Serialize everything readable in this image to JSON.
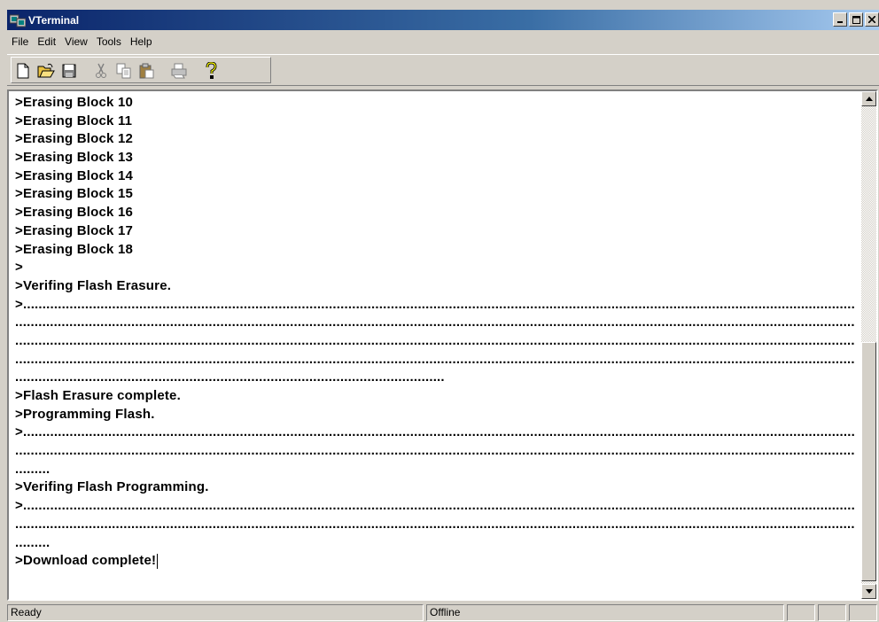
{
  "window": {
    "title": "VTerminal"
  },
  "menu": [
    "File",
    "Edit",
    "View",
    "Tools",
    "Help"
  ],
  "toolbar": {
    "buttons": [
      "new-file-icon",
      "open-folder-icon",
      "save-disk-icon",
      "cut-icon",
      "copy-icon",
      "paste-icon",
      "print-icon",
      "help-icon"
    ]
  },
  "terminal": {
    "lines": [
      ">Erasing Block 10",
      ">Erasing Block 11",
      ">Erasing Block 12",
      ">Erasing Block 13",
      ">Erasing Block 14",
      ">Erasing Block 15",
      ">Erasing Block 16",
      ">Erasing Block 17",
      ">Erasing Block 18",
      ">",
      ">Verifing Flash Erasure.",
      ">.......................................................................................................................................................................................................................",
      ".........................................................................................................................................................................................................................",
      ".........................................................................................................................................................................................................................",
      ".........................................................................................................................................................................................................................",
      "...............................................................................................................",
      ">Flash Erasure complete.",
      ">Programming Flash.",
      ">.......................................................................................................................................................................................................................",
      ".........................................................................................................................................................................................................................",
      ".........",
      ">Verifing Flash Programming.",
      ">.......................................................................................................................................................................................................................",
      ".........................................................................................................................................................................................................................",
      ".........",
      ">Download complete!"
    ]
  },
  "status": {
    "left": "Ready",
    "connection": "Offline",
    "panel3": "",
    "panel4": "",
    "panel5": ""
  },
  "colors": {
    "titlebar_start": "#0a246a",
    "titlebar_end": "#a6caf0",
    "chrome": "#d4d0c8"
  }
}
